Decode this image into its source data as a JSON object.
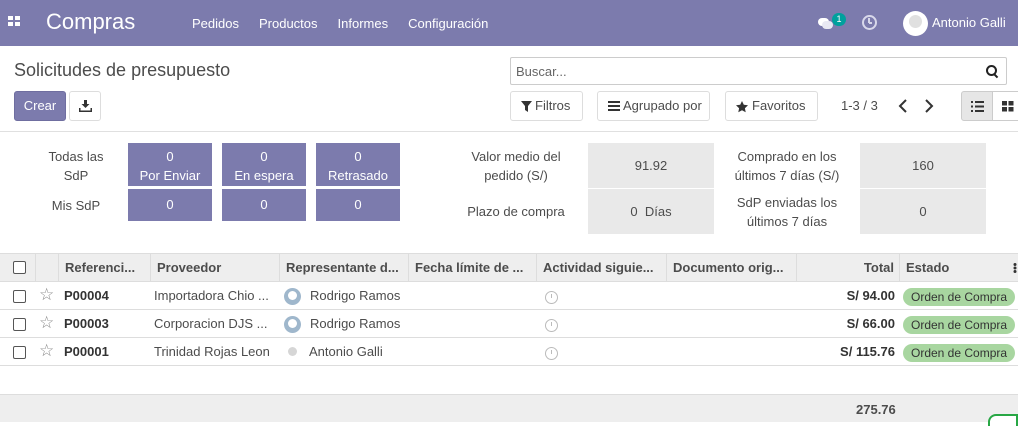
{
  "navbar": {
    "app_title": "Compras",
    "menu": [
      "Pedidos",
      "Productos",
      "Informes",
      "Configuración"
    ],
    "messages_count": "1",
    "user_name": "Antonio Galli"
  },
  "control_panel": {
    "title": "Solicitudes de presupuesto",
    "search_placeholder": "Buscar...",
    "create_label": "Crear",
    "filters_label": "Filtros",
    "group_by_label": "Agrupado por",
    "favorites_label": "Favoritos",
    "pager": "1-3 / 3"
  },
  "dashboard": {
    "all_rfqs_label": "Todas las SdP",
    "my_rfqs_label": "Mis SdP",
    "columns": [
      {
        "all_value": "0",
        "label": "Por Enviar",
        "my_value": "0"
      },
      {
        "all_value": "0",
        "label": "En espera",
        "my_value": "0"
      },
      {
        "all_value": "0",
        "label": "Retrasado",
        "my_value": "0"
      }
    ],
    "avg_order_value_label": "Valor medio del pedido (S/)",
    "avg_order_value": "91.92",
    "lead_time_label": "Plazo de compra",
    "lead_time_value": "0  Días",
    "purchased_7days_label": "Comprado en los últimos 7 días (S/)",
    "purchased_7days_value": "160",
    "rfq_sent_label": "SdP enviadas los últimos 7 días",
    "rfq_sent_value": "0"
  },
  "table": {
    "headers": {
      "reference": "Referenci...",
      "vendor": "Proveedor",
      "representative": "Representante d...",
      "deadline": "Fecha límite de ...",
      "next_activity": "Actividad siguie...",
      "source_document": "Documento orig...",
      "total": "Total",
      "status": "Estado"
    },
    "rows": [
      {
        "reference": "P00004",
        "vendor": "Importadora Chio ...",
        "representative": "Rodrigo Ramos",
        "total": "S/ 94.00",
        "status": "Orden de Compra"
      },
      {
        "reference": "P00003",
        "vendor": "Corporacion DJS ...",
        "representative": "Rodrigo Ramos",
        "total": "S/ 66.00",
        "status": "Orden de Compra"
      },
      {
        "reference": "P00001",
        "vendor": "Trinidad Rojas Leon",
        "representative": "Antonio Galli",
        "total": "S/ 115.76",
        "status": "Orden de Compra"
      }
    ],
    "grand_total": "275.76"
  },
  "colors": {
    "brand": "#7c7bad",
    "status_badge": "#a8d6a0",
    "messages_badge": "#00a09d"
  }
}
